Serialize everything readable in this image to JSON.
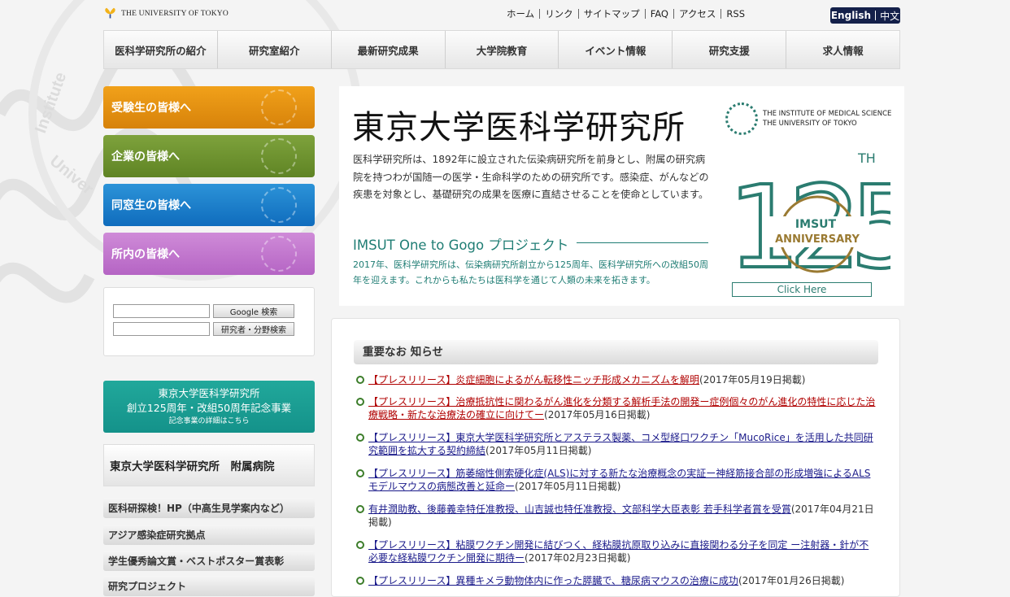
{
  "header": {
    "logo_text": "THE UNIVERSITY OF TOKYO",
    "top_links": [
      "ホーム",
      "リンク",
      "サイトマップ",
      "FAQ",
      "アクセス",
      "RSS"
    ],
    "lang_english": "English",
    "lang_chinese": "中文"
  },
  "nav": {
    "items": [
      "医科学研究所の紹介",
      "研究室紹介",
      "最新研究成果",
      "大学院教育",
      "イベント情報",
      "研究支援",
      "求人情報"
    ]
  },
  "sidebar": {
    "audience_buttons": [
      "受験生の皆様へ",
      "企業の皆様へ",
      "同窓生の皆様へ",
      "所内の皆様へ"
    ],
    "search": {
      "google_button": "Google 検索",
      "researcher_button": "研究者・分野検索"
    },
    "anniversary": {
      "line1": "東京大学医科学研究所",
      "line2": "創立125周年・改組50周年記念事業",
      "line3": "記念事業の詳細はこちら"
    },
    "hospital": "東京大学医科学研究所　附属病院",
    "links": [
      "医科研探検！HP（中高生見学案内など）",
      "アジア感染症研究拠点",
      "学生優秀論文賞・ベストポスター賞表彰",
      "研究プロジェクト"
    ]
  },
  "hero": {
    "title": "東京大学医科学研究所",
    "description": "医科学研究所は、1892年に設立された伝染病研究所を前身とし、附属の研究病院を持つわが国随一の医学・生命科学のための研究所です。感染症、がんなどの疾患を対象とし、基礎研究の成果を医療に直結させることを使命としています。",
    "project_title": "IMSUT One to Gogo プロジェクト",
    "project_desc": "2017年、医科学研究所は、伝染病研究所創立から125周年、医科学研究所への改組50周年を迎えます。これからも私たちは医科学を通じて人類の未来を拓きます。",
    "logo_line1": "THE INSTITUTE OF MEDICAL SCIENCE",
    "logo_line2": "THE UNIVERSITY OF TOKYO",
    "anniv_number": "125",
    "anniv_th": "TH",
    "anniv_imsut": "IMSUT",
    "anniv_word": "ANNIVERSARY",
    "click_here": "Click Here"
  },
  "news": {
    "heading": "重要なお 知らせ",
    "items": [
      {
        "link": "【プレスリリース】炎症細胞によるがん転移性ニッチ形成メカニズムを解明",
        "date": "(2017年05月19日掲載)"
      },
      {
        "link": "【プレスリリース】治療抵抗性に関わるがん進化を分類する解析手法の開発ー症例個々のがん進化の特性に応じた治療戦略・新たな治療法の確立に向けてー",
        "date": "(2017年05月16日掲載)"
      },
      {
        "link": "【プレスリリース】東京大学医科学研究所とアステラス製薬、コメ型経口ワクチン「MucoRice」を活用した共同研究範囲を拡大する契約締結",
        "date": "(2017年05月11日掲載)"
      },
      {
        "link": "【プレスリリース】筋萎縮性側索硬化症(ALS)に対する新たな治療概念の実証ー神経筋接合部の形成増強によるALSモデルマウスの病態改善と延命ー",
        "date": "(2017年05月11日掲載)"
      },
      {
        "link": "有井潤助教、後藤義幸特任准教授、山吉誠也特任准教授、文部科学大臣表彰 若手科学者賞を受賞",
        "date": "(2017年04月21日掲載)"
      },
      {
        "link": "【プレスリリース】粘膜ワクチン開発に結びつく、経粘膜抗原取り込みに直接関わる分子を同定 ー注射器・針が不必要な経粘膜ワクチン開発に期待ー",
        "date": "(2017年02月23日掲載)"
      },
      {
        "link": "【プレスリリース】異種キメラ動物体内に作った膵臓で、糖尿病マウスの治療に成功",
        "date": "(2017年01月26日掲載)"
      }
    ]
  }
}
